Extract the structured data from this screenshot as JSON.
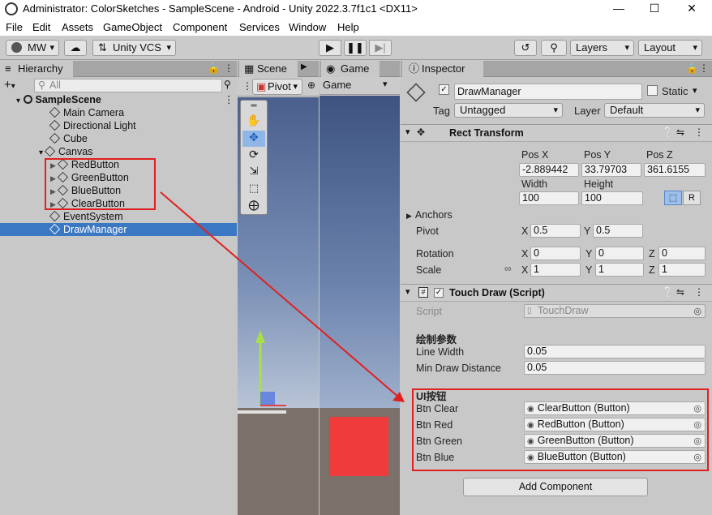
{
  "window": {
    "title": "Administrator: ColorSketches - SampleScene - Android - Unity 2022.3.7f1c1 <DX11>",
    "minimize": "—",
    "maximize": "☐",
    "close": "✕"
  },
  "menu": [
    "File",
    "Edit",
    "Assets",
    "GameObject",
    "Component",
    "Services",
    "Window",
    "Help"
  ],
  "toolbar": {
    "account": "MW",
    "vcs": "Unity VCS",
    "layers": "Layers",
    "layout": "Layout"
  },
  "hierarchy": {
    "tab": "Hierarchy",
    "search_placeholder": "All",
    "scene": "SampleScene",
    "items": [
      "Main Camera",
      "Directional Light",
      "Cube",
      "Canvas",
      "RedButton",
      "GreenButton",
      "BlueButton",
      "ClearButton",
      "EventSystem",
      "DrawManager"
    ]
  },
  "scene_view": {
    "tab": "Scene",
    "pivot": "Pivot"
  },
  "game_view": {
    "tab": "Game",
    "display": "Game"
  },
  "inspector": {
    "tab": "Inspector",
    "object_name": "DrawManager",
    "static_label": "Static",
    "tag_label": "Tag",
    "tag_value": "Untagged",
    "layer_label": "Layer",
    "layer_value": "Default",
    "rect_transform": {
      "title": "Rect Transform",
      "posx_label": "Pos X",
      "posy_label": "Pos Y",
      "posz_label": "Pos Z",
      "posx": "-2.889442",
      "posy": "33.79703",
      "posz": "361.6155",
      "width_label": "Width",
      "height_label": "Height",
      "width": "100",
      "height": "100",
      "anchors": "Anchors",
      "pivot_label": "Pivot",
      "pivot_x": "0.5",
      "pivot_y": "0.5",
      "rotation_label": "Rotation",
      "rot_x": "0",
      "rot_y": "0",
      "rot_z": "0",
      "scale_label": "Scale",
      "scale_x": "1",
      "scale_y": "1",
      "scale_z": "1",
      "x": "X",
      "y": "Y",
      "z": "Z",
      "r": "R"
    },
    "touch_draw": {
      "title": "Touch Draw (Script)",
      "script_label": "Script",
      "script_value": "TouchDraw",
      "section1": "绘制参数",
      "line_width_label": "Line Width",
      "line_width": "0.05",
      "min_dist_label": "Min Draw Distance",
      "min_dist": "0.05",
      "section2": "UI按钮",
      "btn_clear_label": "Btn Clear",
      "btn_clear": "ClearButton (Button)",
      "btn_red_label": "Btn Red",
      "btn_red": "RedButton (Button)",
      "btn_green_label": "Btn Green",
      "btn_green": "GreenButton (Button)",
      "btn_blue_label": "Btn Blue",
      "btn_blue": "BlueButton (Button)"
    },
    "add_component": "Add Component"
  },
  "colors": {
    "selection": "#3a78c3",
    "annotation": "#e02020",
    "game_red": "#ef3b3b"
  }
}
